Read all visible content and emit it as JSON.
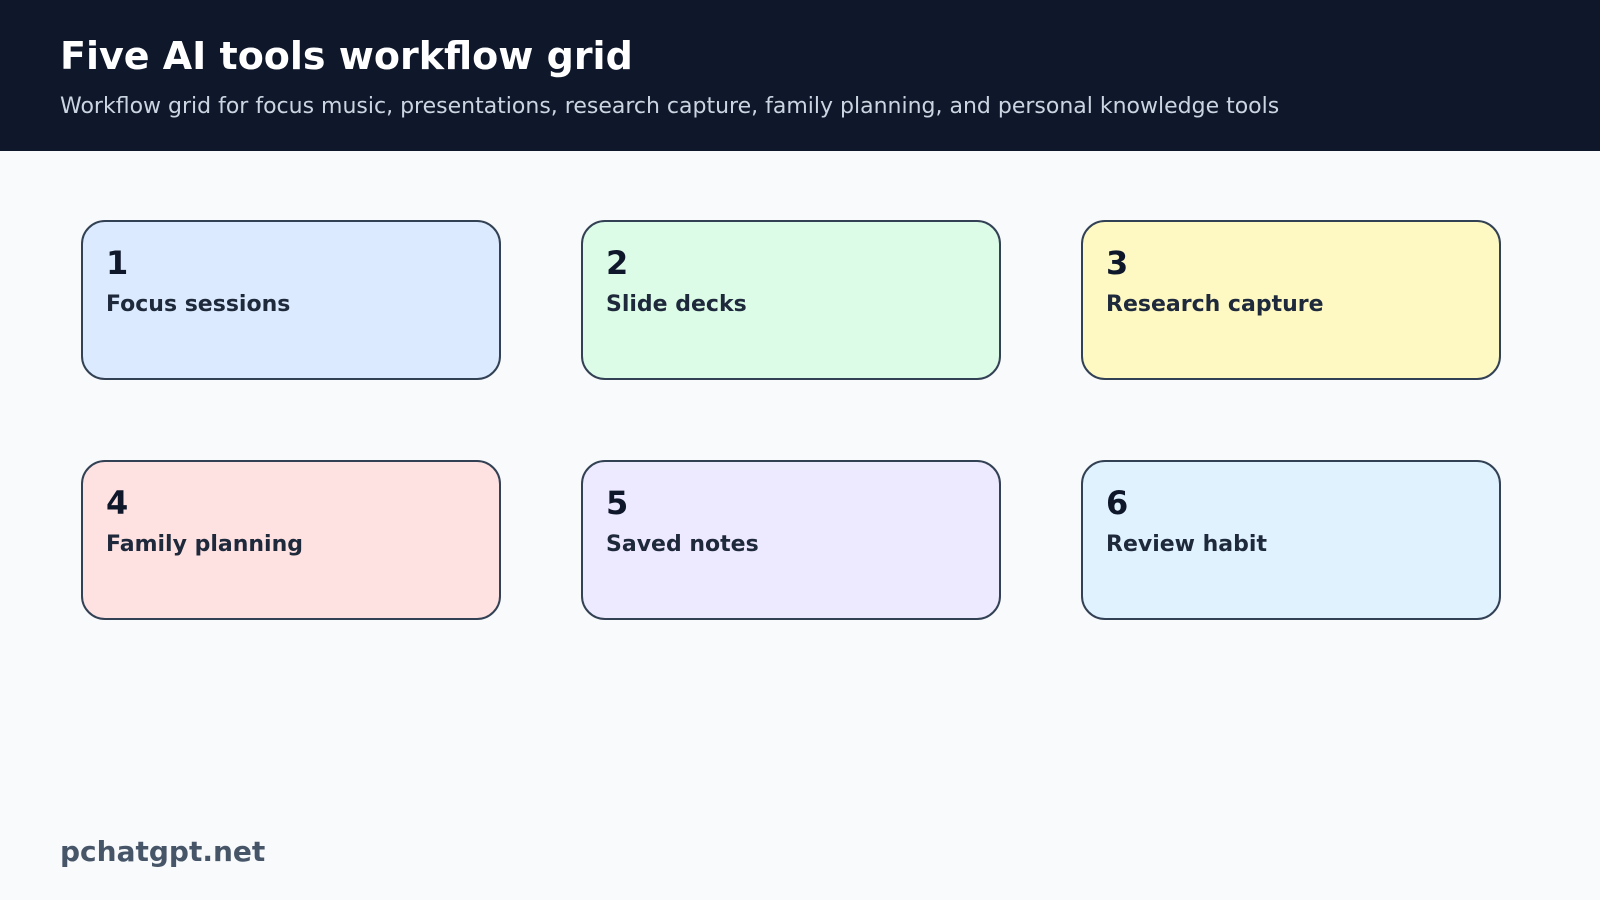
{
  "header": {
    "title": "Five AI tools workflow grid",
    "subtitle": "Workflow grid for focus music, presentations, research capture, family planning, and personal knowledge tools"
  },
  "cards": [
    {
      "number": "1",
      "label": "Focus sessions",
      "color": "#dbeafe"
    },
    {
      "number": "2",
      "label": "Slide decks",
      "color": "#dcfce7"
    },
    {
      "number": "3",
      "label": "Research capture",
      "color": "#fef9c3"
    },
    {
      "number": "4",
      "label": "Family planning",
      "color": "#fee2e2"
    },
    {
      "number": "5",
      "label": "Saved notes",
      "color": "#ede9fe"
    },
    {
      "number": "6",
      "label": "Review habit",
      "color": "#e0f2fe"
    }
  ],
  "footer": {
    "brand": "pchatgpt.net"
  }
}
